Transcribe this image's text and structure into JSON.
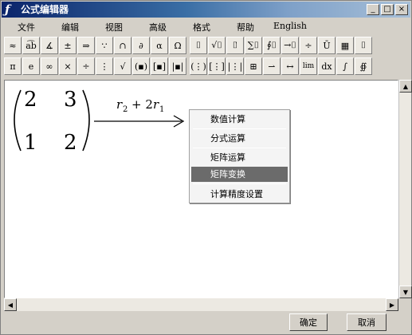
{
  "window": {
    "title": "公式编辑器",
    "icon": "formula-f-icon"
  },
  "title_buttons": [
    "_",
    "□",
    "×"
  ],
  "menu": [
    "文件",
    "编辑",
    "视图",
    "高级",
    "格式",
    "帮助",
    "English"
  ],
  "toolbar1": [
    "≈",
    "a͡b",
    "∡",
    "±",
    "⇒",
    "∵",
    "∩",
    "∂",
    "α",
    "Ω",
    "⌷",
    "√⌷",
    "⌷̇",
    "∑⌷",
    "∮⌷",
    "→⌷",
    "÷",
    "Ū",
    "▦",
    "⌷"
  ],
  "toolbar2": [
    "π",
    "e",
    "∞",
    "×",
    "÷",
    "⋮",
    "√",
    "(▪)",
    "[▪]",
    "|▪|",
    "(⋮)",
    "[⋮]",
    "|⋮|",
    "⊞",
    "⇀",
    "↔",
    "lim",
    "dx",
    "∫",
    "∯"
  ],
  "editor": {
    "matrix": [
      [
        "2",
        "3"
      ],
      [
        "1",
        "2"
      ]
    ],
    "arrow_label": "r2 + 2r1",
    "arrow_label_parts": {
      "a": "r",
      "a_sub": "2",
      "op": "+ 2",
      "b": "r",
      "b_sub": "1"
    }
  },
  "context_menu": {
    "items": [
      "数值计算",
      "分式运算",
      "矩阵运算",
      "矩阵变换",
      "计算精度设置"
    ],
    "active": "矩阵变换"
  },
  "buttons": {
    "ok": "确定",
    "cancel": "取消"
  }
}
